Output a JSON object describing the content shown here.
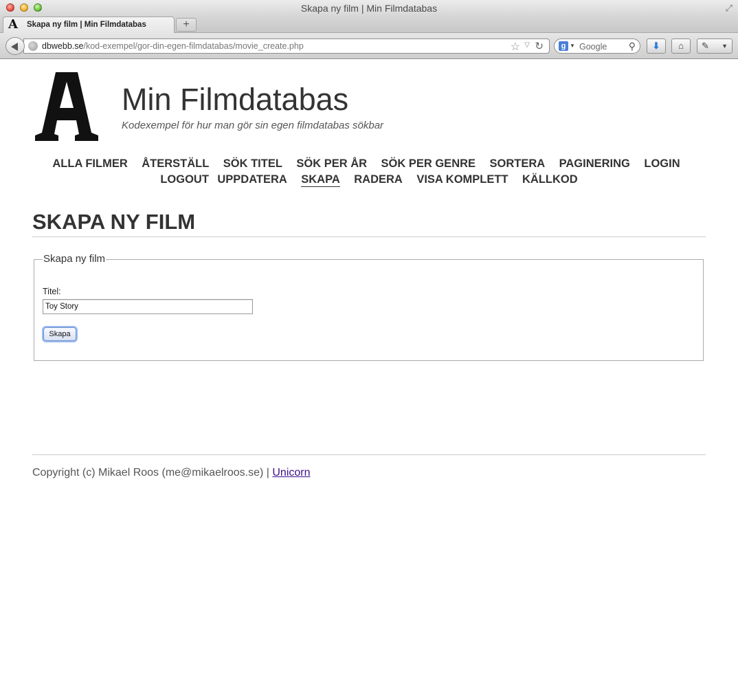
{
  "window": {
    "title": "Skapa ny film | Min Filmdatabas"
  },
  "tabs": [
    {
      "label": "Skapa ny film | Min Filmdatabas",
      "favicon": "A"
    }
  ],
  "browser": {
    "new_tab_label": "+",
    "url_domain": "dbwebb.se",
    "url_path": "/kod-exempel/gor-din-egen-filmdatabas/movie_create.php",
    "search_engine_letter": "g",
    "search_placeholder": "Google"
  },
  "site": {
    "logo_letter": "A",
    "title": "Min Filmdatabas",
    "slogan": "Kodexempel för hur man gör sin egen filmdatabas sökbar"
  },
  "navmenu": [
    {
      "label": "ALLA FILMER"
    },
    {
      "label": "ÅTERSTÄLL"
    },
    {
      "label": "SÖK TITEL"
    },
    {
      "label": "SÖK PER ÅR"
    },
    {
      "label": "SÖK PER GENRE"
    },
    {
      "label": "SORTERA"
    },
    {
      "label": "PAGINERING"
    },
    {
      "label": "LOGIN"
    },
    {
      "label": "LOGOUT"
    },
    {
      "label": "UPPDATERA"
    },
    {
      "label": "SKAPA",
      "selected": true
    },
    {
      "label": "RADERA"
    },
    {
      "label": "VISA KOMPLETT"
    },
    {
      "label": "KÄLLKOD"
    }
  ],
  "main": {
    "heading": "SKAPA NY FILM",
    "form": {
      "legend": "Skapa ny film",
      "title_label": "Titel:",
      "title_value": "Toy Story",
      "submit_label": "Skapa"
    }
  },
  "footer": {
    "text": "Copyright (c) Mikael Roos (me@mikaelroos.se) | ",
    "link": "Unicorn"
  },
  "colors": {
    "text": "#333333",
    "link_visited": "#3b0f8a",
    "rule": "#cccccc",
    "focus_ring": "#9bbcf2"
  }
}
